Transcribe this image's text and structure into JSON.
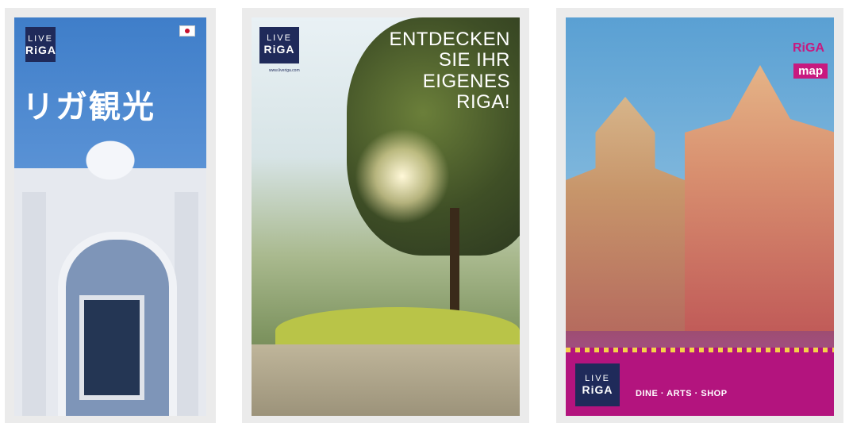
{
  "cards": [
    {
      "logo": {
        "line1": "LIVE",
        "line2": "RiGA"
      },
      "title": "リガ観光"
    },
    {
      "logo": {
        "line1": "LIVE",
        "line2": "RiGA"
      },
      "url": "www.liveriga.com",
      "title_lines": [
        "ENTDECKEN",
        "SIE IHR",
        "EIGENES",
        "RIGA!"
      ]
    },
    {
      "logo": {
        "line1": "LIVE",
        "line2": "RiGA"
      },
      "riga_label": "RiGA",
      "map_label": "map",
      "tagline": "DINE · ARTS · SHOP"
    }
  ],
  "colors": {
    "logo_navy": "#1f2a5a",
    "brand_magenta": "#c8197f"
  }
}
